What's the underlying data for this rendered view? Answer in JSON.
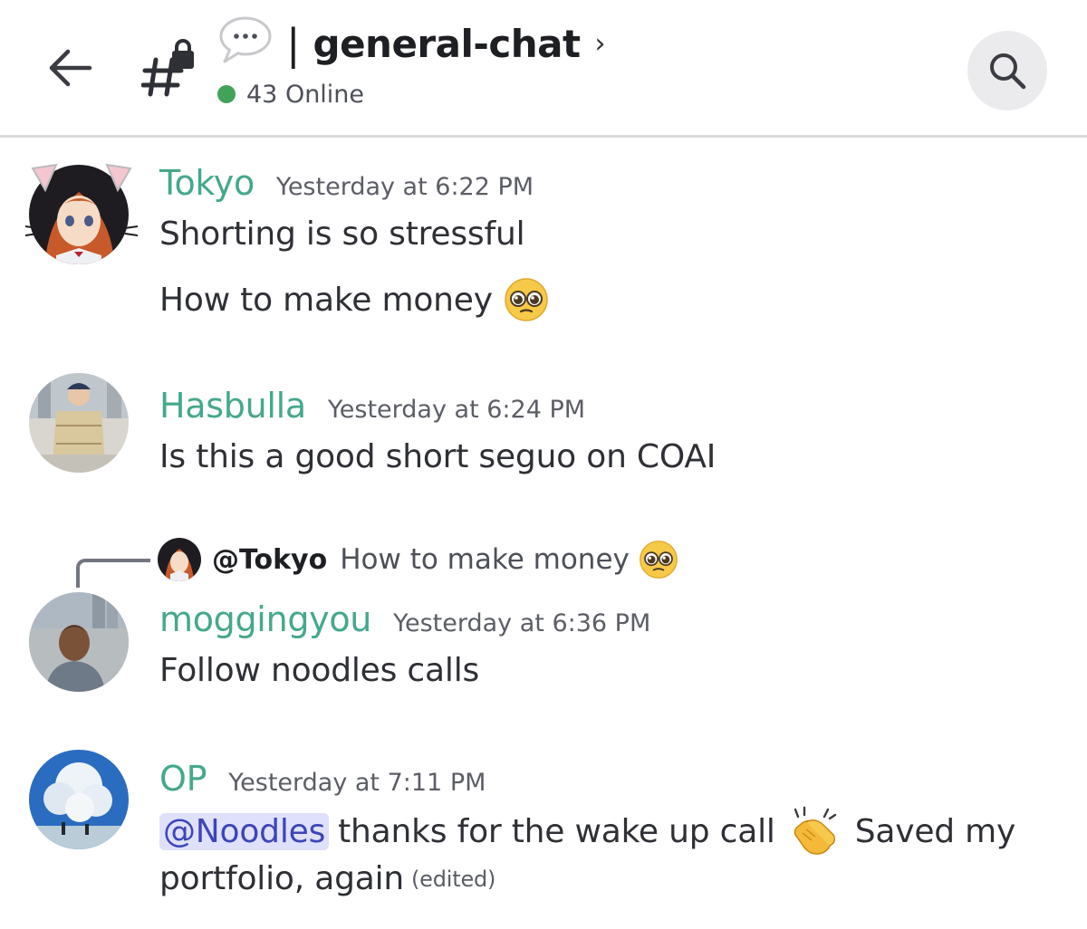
{
  "header": {
    "title": "general-chat",
    "separator": "|",
    "chevron": "›",
    "online": "43 Online",
    "icons": [
      "back-arrow-icon",
      "locked-hash-icon",
      "speech-bubble-icon",
      "chevron-right-icon",
      "search-icon"
    ],
    "colors": {
      "online_dot": "#43a25a",
      "divider": "#d9dadd"
    }
  },
  "messages": [
    {
      "author": "Tokyo",
      "timestamp": "Yesterday at 6:22 PM",
      "lines": [
        "Shorting is so stressful",
        "How to make money"
      ],
      "emoji": "pleading-face"
    },
    {
      "author": "Hasbulla",
      "timestamp": "Yesterday at 6:24 PM",
      "lines": [
        "Is this a good short seguo on COAI"
      ]
    },
    {
      "reply": {
        "user": "@Tokyo",
        "text": "How to make money",
        "emoji": "pleading-face"
      },
      "author": "moggingyou",
      "timestamp": "Yesterday at 6:36 PM",
      "lines": [
        "Follow noodles calls"
      ]
    },
    {
      "author": "OP",
      "timestamp": "Yesterday at 7:11 PM",
      "mention": "@Noodles",
      "line1_rest": "thanks for the wake up call",
      "emoji": "clapping-hands",
      "line1_after": "Saved my",
      "line2": "portfolio, again",
      "edited": "(edited)"
    }
  ],
  "colors": {
    "username": "#45a88d",
    "mention_bg": "#dfe0fb",
    "mention_text": "#3d45b8"
  }
}
